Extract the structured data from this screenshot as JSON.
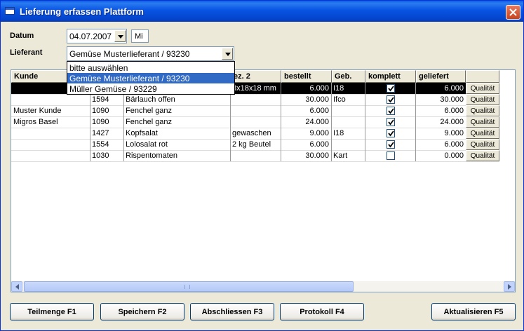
{
  "window": {
    "title": "Lieferung erfassen Plattform"
  },
  "form": {
    "datum_label": "Datum",
    "datum_value": "04.07.2007",
    "weekday": "Mi",
    "lieferant_label": "Lieferant",
    "lieferant_value": "Gemüse Musterlieferant / 93230",
    "lieferant_options": [
      "bitte auswählen",
      "Gemüse Musterlieferant / 93230",
      "Müller Gemüse / 93229"
    ]
  },
  "grid": {
    "columns": [
      "Kunde",
      "",
      "",
      "ez. 2",
      "bestellt",
      "Geb.",
      "komplett",
      "geliefert",
      ""
    ],
    "quality_label": "Qualität",
    "rows": [
      {
        "kunde": "",
        "nr": "",
        "artikel": "",
        "bez2": "8x18x18 mm",
        "bestellt": "6.000",
        "geb": "I18",
        "komplett": true,
        "geliefert": "6.000"
      },
      {
        "kunde": "",
        "nr": "1594",
        "artikel": "Bärlauch offen",
        "bez2": "",
        "bestellt": "30.000",
        "geb": "Ifco",
        "komplett": true,
        "geliefert": "30.000"
      },
      {
        "kunde": "Muster Kunde",
        "nr": "1090",
        "artikel": "Fenchel ganz",
        "bez2": "",
        "bestellt": "6.000",
        "geb": "",
        "komplett": true,
        "geliefert": "6.000"
      },
      {
        "kunde": "Migros Basel",
        "nr": "1090",
        "artikel": "Fenchel ganz",
        "bez2": "",
        "bestellt": "24.000",
        "geb": "",
        "komplett": true,
        "geliefert": "24.000"
      },
      {
        "kunde": "",
        "nr": "1427",
        "artikel": "Kopfsalat",
        "bez2": "gewaschen",
        "bestellt": "9.000",
        "geb": "I18",
        "komplett": true,
        "geliefert": "9.000"
      },
      {
        "kunde": "",
        "nr": "1554",
        "artikel": "Lolosalat rot",
        "bez2": "2 kg Beutel",
        "bestellt": "6.000",
        "geb": "",
        "komplett": true,
        "geliefert": "6.000"
      },
      {
        "kunde": "",
        "nr": "1030",
        "artikel": "Rispentomaten",
        "bez2": "",
        "bestellt": "30.000",
        "geb": "Kart",
        "komplett": false,
        "geliefert": "0.000"
      }
    ]
  },
  "buttons": {
    "teilmenge": "Teilmenge F1",
    "speichern": "Speichern F2",
    "abschliessen": "Abschliessen F3",
    "protokoll": "Protokoll F4",
    "aktualisieren": "Aktualisieren F5"
  },
  "colors": {
    "titlebar": "#0854E3",
    "selection": "#316AC5",
    "face": "#ECE9D8"
  }
}
